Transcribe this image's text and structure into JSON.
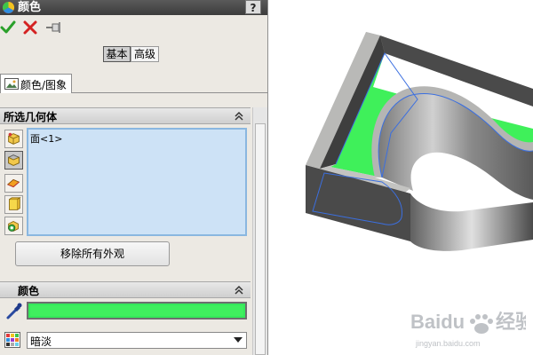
{
  "window": {
    "title": "颜色",
    "help_label": "?"
  },
  "toolbar": {
    "ok_icon": "checkmark-icon",
    "cancel_icon": "x-icon",
    "pin_icon": "pushpin-icon"
  },
  "mode": {
    "basic_label": "基本",
    "advanced_label": "高级",
    "selected": "basic"
  },
  "tabs": [
    {
      "label": "颜色/图象",
      "icon": "image-icon"
    }
  ],
  "selected_geometry": {
    "title": "所选几何体",
    "filters": [
      "part-filter-icon",
      "face-filter-icon",
      "surface-filter-icon",
      "body-filter-icon",
      "feature-filter-icon"
    ],
    "active_filter": "face-filter-icon",
    "items": [
      "面<1>"
    ],
    "remove_button_label": "移除所有外观"
  },
  "color_section": {
    "title": "颜色",
    "swatch_color": "#40ef5e",
    "shade_options_selected": "暗淡"
  },
  "watermark": {
    "brand": "Baidu",
    "brand_cn": "经验",
    "url": "jingyan.baidu.com"
  },
  "colors": {
    "accent_green": "#40ef5e",
    "selection_blue": "#cde2f6",
    "model_gray": "#4a4a4a",
    "panel_bg": "#ece9e3"
  }
}
